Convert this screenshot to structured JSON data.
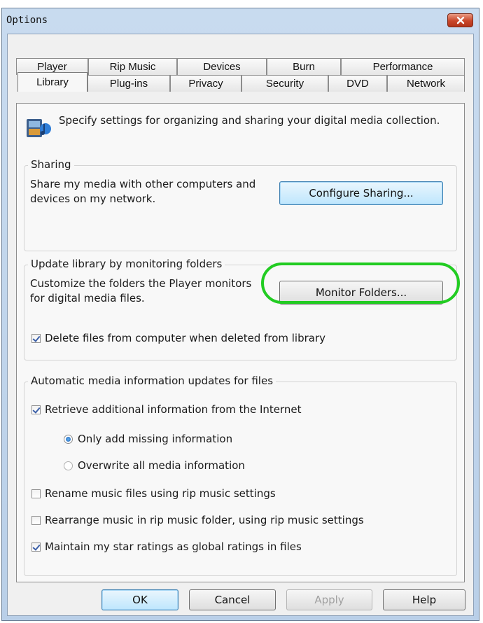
{
  "window": {
    "title": "Options",
    "close_icon": "close-icon"
  },
  "tabs_row1": [
    "Player",
    "Rip Music",
    "Devices",
    "Burn",
    "Performance"
  ],
  "tabs_row2": [
    "Library",
    "Plug-ins",
    "Privacy",
    "Security",
    "DVD",
    "Network"
  ],
  "active_tab": "Library",
  "description": "Specify settings for organizing and sharing your digital media collection.",
  "sharing": {
    "legend": "Sharing",
    "text": "Share my media with other computers and devices on my network.",
    "button": "Configure Sharing..."
  },
  "monitor": {
    "legend": "Update library by monitoring folders",
    "text": "Customize the folders the Player monitors for digital media files.",
    "button": "Monitor Folders...",
    "delete_checkbox": {
      "label": "Delete files from computer when deleted from library",
      "checked": true
    }
  },
  "auto_updates": {
    "legend": "Automatic media information updates for files",
    "retrieve": {
      "label": "Retrieve additional information from the Internet",
      "checked": true
    },
    "radio_missing": {
      "label": "Only add missing information",
      "selected": true
    },
    "radio_overwrite": {
      "label": "Overwrite all media information",
      "selected": false
    },
    "rename": {
      "label": "Rename music files using rip music settings",
      "checked": false
    },
    "rearrange": {
      "label": "Rearrange music in rip music folder, using rip music settings",
      "checked": false
    },
    "maintain": {
      "label": "Maintain my star ratings as global ratings in files",
      "checked": true
    }
  },
  "footer": {
    "ok": "OK",
    "cancel": "Cancel",
    "apply": "Apply",
    "help": "Help"
  },
  "colors": {
    "highlight": "#22cc22",
    "title_bar": "#c8dbef",
    "close_button": "#c9472a"
  }
}
